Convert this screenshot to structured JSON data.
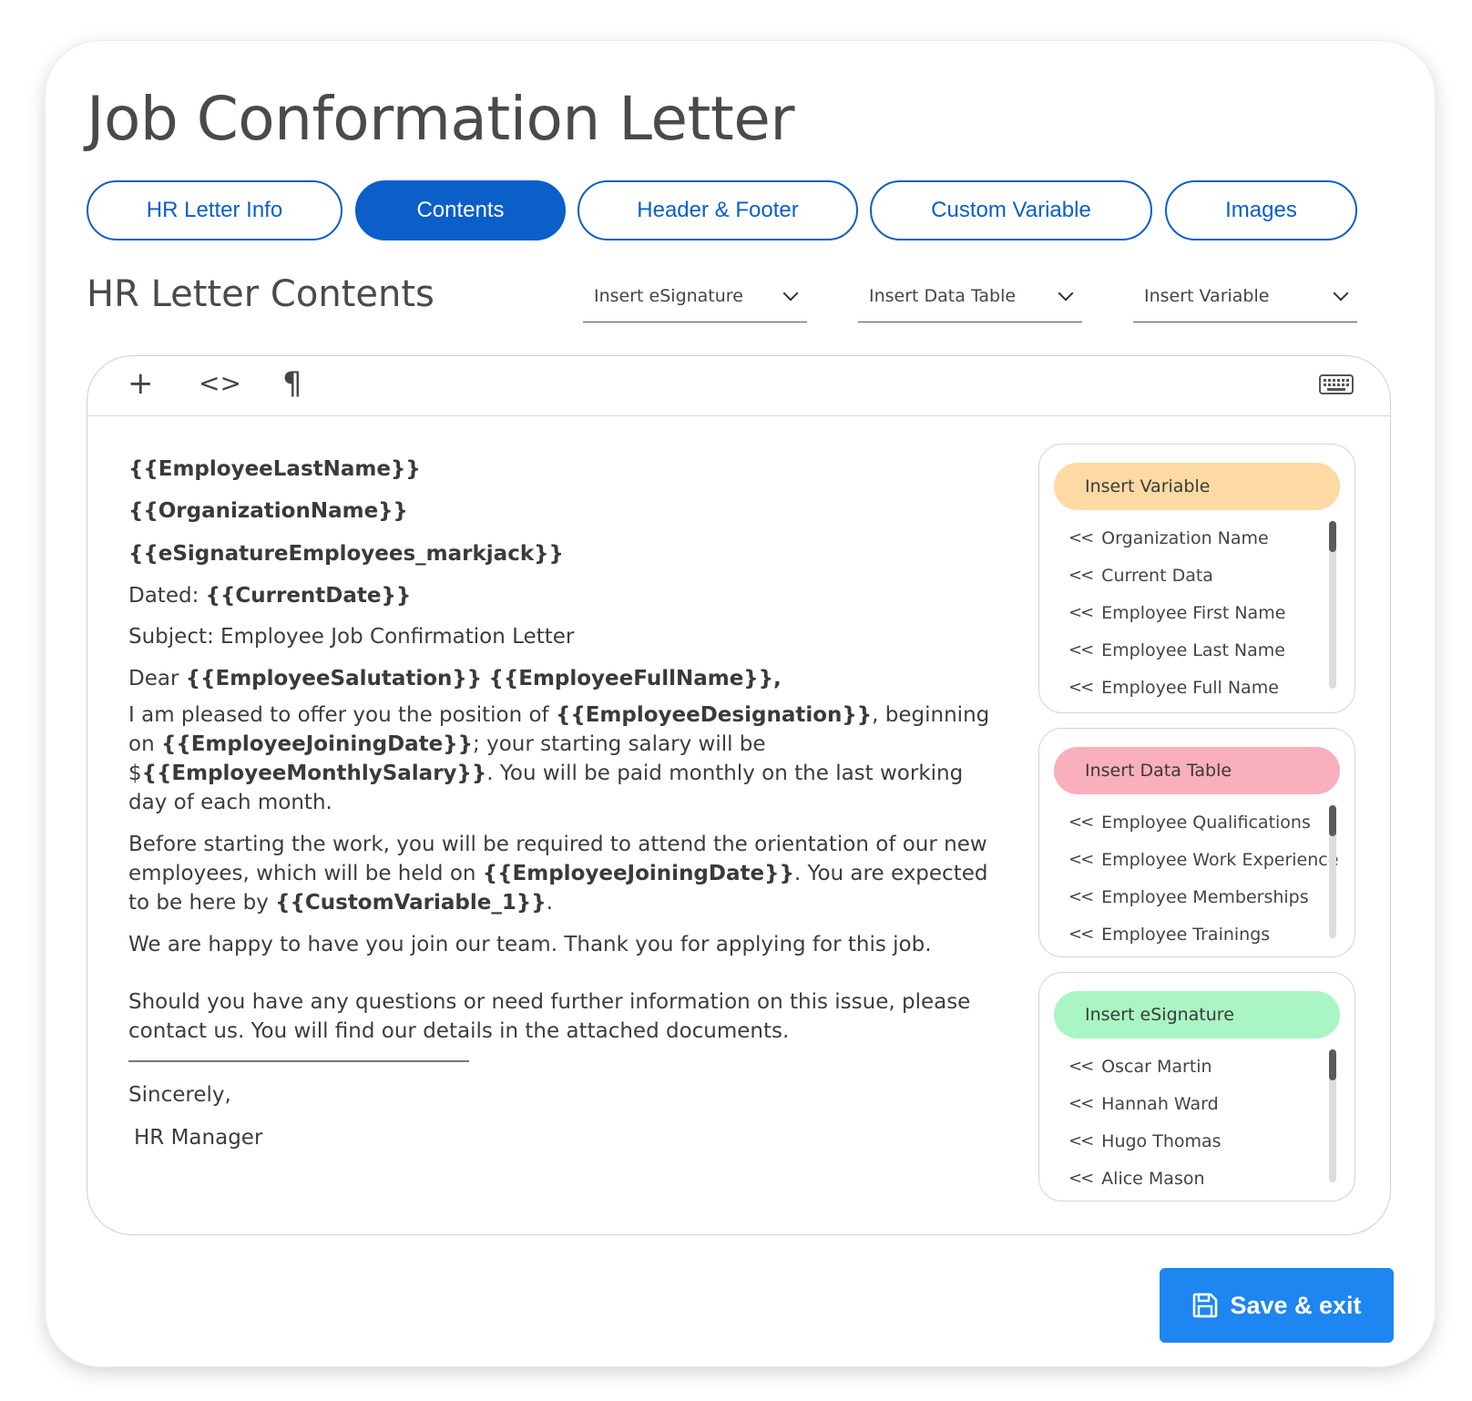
{
  "page_title": "Job Conformation Letter",
  "tabs": [
    {
      "label": "HR Letter Info",
      "active": false
    },
    {
      "label": "Contents",
      "active": true
    },
    {
      "label": "Header & Footer",
      "active": false
    },
    {
      "label": "Custom Variable",
      "active": false
    },
    {
      "label": "Images",
      "active": false
    }
  ],
  "section_title": "HR Letter Contents",
  "dropdowns": {
    "esignature": "Insert eSignature",
    "data_table": "Insert Data Table",
    "variable": "Insert Variable"
  },
  "toolbar": {
    "add": "+",
    "code": "<>",
    "paragraph": "¶"
  },
  "letter": {
    "line1": "{{EmployeeLastName}}",
    "line2": "{{OrganizationName}}",
    "line3": "{{eSignatureEmployees_markjack}}",
    "dated_label": "Dated: ",
    "dated_var": "{{CurrentDate}}",
    "subject": "Subject: Employee Job Confirmation Letter",
    "dear_label": "Dear ",
    "dear_var1": "{{EmployeeSalutation}}",
    "dear_var2": "{{EmployeeFullName}},",
    "p1_a": "I am pleased to offer you the position of ",
    "p1_var1": "{{EmployeeDesignation}}",
    "p1_b": ", beginning on ",
    "p1_var2": "{{EmployeeJoiningDate}}",
    "p1_c": "; your starting salary will be $",
    "p1_var3": "{{EmployeeMonthlySalary}}",
    "p1_d": ". You will be paid monthly on the last working day of each month.",
    "p2_a": "Before starting the work, you will be required to attend the orientation of our new employees, which will be held on ",
    "p2_var1": "{{EmployeeJoiningDate}}",
    "p2_b": ". You are expected to be here by ",
    "p2_var2": "{{CustomVariable_1}}",
    "p2_c": ".",
    "p3": "We are happy to have you join our team. Thank you for applying for this job.",
    "p4": "Should you have any questions or need further information on this issue, please contact us. You will find our details in the attached documents.",
    "closing": "Sincerely,",
    "signature": "HR Manager"
  },
  "panels": {
    "variable": {
      "title": "Insert Variable",
      "color": "#fdd9a3",
      "items": [
        "Organization Name",
        "Current Data",
        "Employee First Name",
        "Employee Last Name",
        "Employee Full Name"
      ]
    },
    "data_table": {
      "title": "Insert Data Table",
      "color": "#f9afbc",
      "items": [
        "Employee Qualifications",
        "Employee Work Experience",
        "Employee Memberships",
        "Employee Trainings"
      ]
    },
    "esignature": {
      "title": "Insert eSignature",
      "color": "#a9f5c4",
      "items": [
        "Oscar Martin",
        "Hannah Ward",
        "Hugo Thomas",
        "Alice Mason"
      ]
    }
  },
  "item_prefix": "<<",
  "save_button": "Save & exit",
  "colors": {
    "primary": "#0a5fc9",
    "save": "#1d86f0"
  }
}
